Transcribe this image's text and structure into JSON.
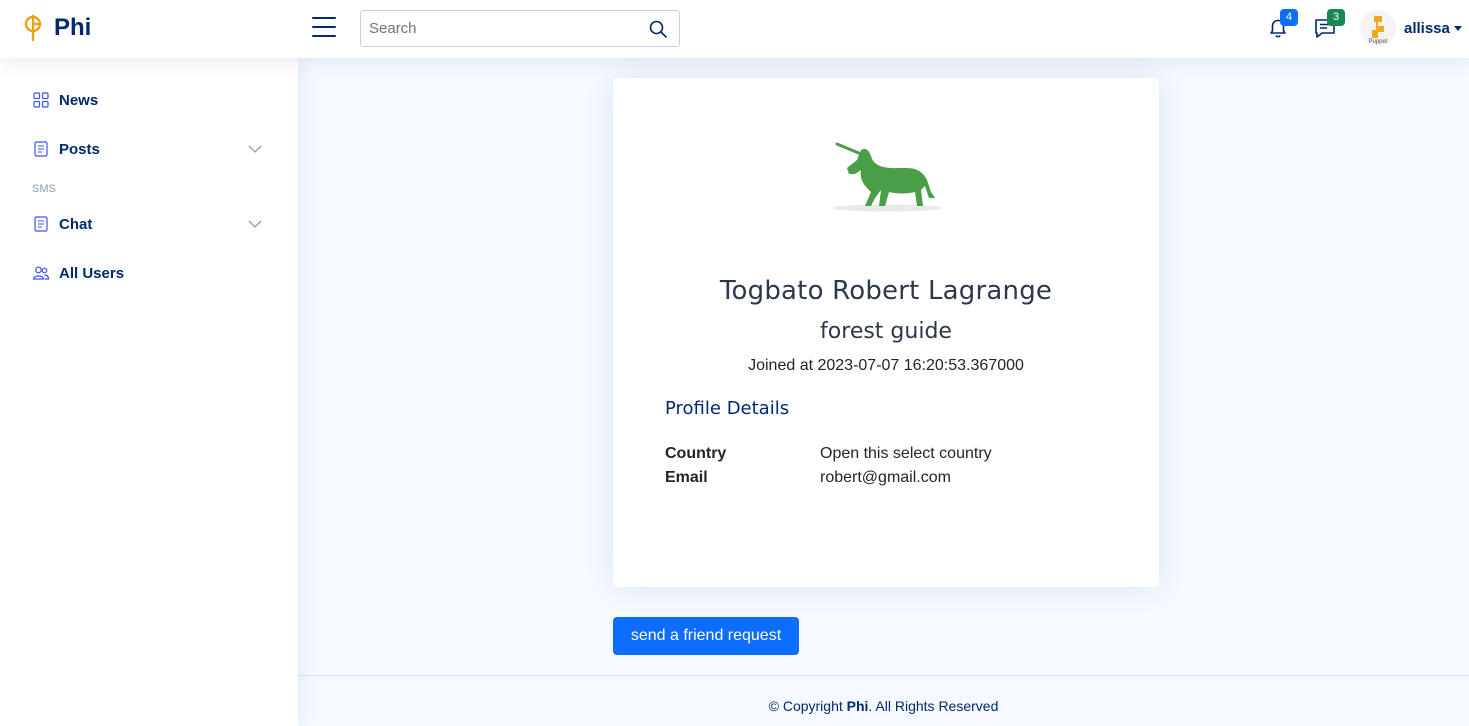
{
  "header": {
    "brand": "Phi",
    "search_placeholder": "Search",
    "notifications_count": "4",
    "messages_count": "3",
    "avatar_label": "Puppet",
    "user_name": "allissa"
  },
  "sidebar": {
    "items": [
      {
        "label": "News",
        "icon": "grid-icon"
      },
      {
        "label": "Posts",
        "icon": "document-icon"
      },
      {
        "heading": "SMS"
      },
      {
        "label": "Chat",
        "icon": "document-icon"
      },
      {
        "label": "All Users",
        "icon": "people-icon"
      }
    ]
  },
  "profile": {
    "full_name": "Togbato Robert Lagrange",
    "occupation": "forest guide",
    "joined": "Joined at 2023-07-07 16:20:53.367000",
    "details_title": "Profile Details",
    "details": [
      {
        "label": "Country",
        "value": "Open this select country"
      },
      {
        "label": "Email",
        "value": "robert@gmail.com"
      }
    ],
    "friend_button": "send a friend request"
  },
  "footer": {
    "prefix": "© Copyright ",
    "brand": "Phi",
    "suffix": ". All Rights Reserved"
  },
  "colors": {
    "primary": "#012970",
    "accent_blue": "#0d6efd",
    "badge_green": "#198754",
    "logo_gold": "#e8a317",
    "unicorn_green": "#4a9e47"
  }
}
